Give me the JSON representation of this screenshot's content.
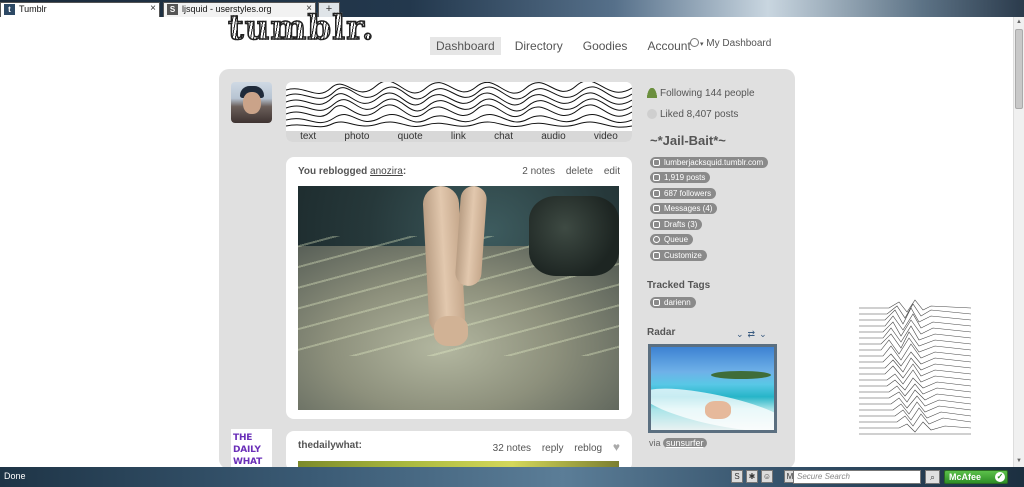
{
  "browser": {
    "tabs": [
      {
        "title": "Tumblr",
        "active": true,
        "favicon": "t"
      },
      {
        "title": "ljsquid - userstyles.org",
        "active": false,
        "favicon": "S"
      }
    ],
    "new_tab_label": "+",
    "status_text": "Done",
    "search_placeholder": "Secure Search",
    "mcafee_label": "McAfee"
  },
  "header": {
    "logo": "tumblr.",
    "nav": [
      "Dashboard",
      "Directory",
      "Goodies",
      "Account"
    ],
    "search_label": "My Dashboard"
  },
  "post_types": [
    "text",
    "photo",
    "quote",
    "link",
    "chat",
    "audio",
    "video"
  ],
  "posts": [
    {
      "prefix": "You reblogged ",
      "source": "anozira",
      "suffix": ":",
      "notes": "2 notes",
      "actions": [
        "delete",
        "edit"
      ]
    },
    {
      "author": "thedailywhat:",
      "notes": "32 notes",
      "actions": [
        "reply",
        "reblog"
      ]
    }
  ],
  "avatar2_text": "THE DAILY WHAT",
  "sidebar": {
    "following": "Following 144 people",
    "liked": "Liked 8,407 posts",
    "blog_name": "~*Jail-Bait*~",
    "blog_items": [
      "lumberjacksquid.tumblr.com",
      "1,919 posts",
      "687 followers",
      "Messages (4)",
      "Drafts (3)",
      "Queue",
      "Customize"
    ],
    "tracked_tags_title": "Tracked Tags",
    "tracked_tags": [
      "darienn"
    ],
    "radar_title": "Radar",
    "radar_via": "via",
    "radar_user": "sunsurfer"
  },
  "colors": {
    "container_bg": "#e0e0e0",
    "pill_bg": "#8a8a8a",
    "accent_link": "#3a5b80"
  }
}
